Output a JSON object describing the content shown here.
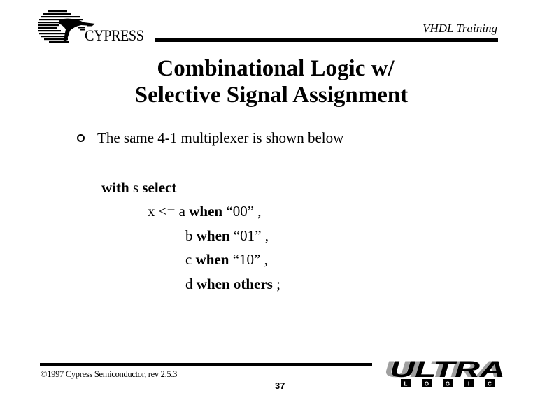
{
  "header": {
    "company_name": "CYPRESS",
    "course_title": "VHDL Training",
    "logo_icon": "cypress-tree-logo-icon"
  },
  "slide": {
    "title_line1": "Combinational Logic w/",
    "title_line2": "Selective Signal Assignment",
    "bullet_icon": "hollow-circle-bullet-icon",
    "bullet_text": "The same 4-1 multiplexer is shown below"
  },
  "code": {
    "line1": {
      "kw1": "with",
      "plain1": " s ",
      "kw2": "select"
    },
    "line2": {
      "plain1": "x <= a ",
      "kw1": "when",
      "plain2": " “00” ,"
    },
    "line3": {
      "plain1": "b ",
      "kw1": "when",
      "plain2": " “01” ,"
    },
    "line4": {
      "plain1": "c ",
      "kw1": "when",
      "plain2": " “10” ,"
    },
    "line5": {
      "plain1": "d ",
      "kw1": "when",
      "plain2": " ",
      "kw2": "others",
      "plain3": " ;"
    }
  },
  "footer": {
    "copyright": "©1997 Cypress Semiconductor, rev 2.5.3",
    "page_number": "37",
    "brand_word": "ULTRA",
    "brand_letters": [
      "L",
      "O",
      "G",
      "I",
      "C"
    ],
    "logo_icon": "ultra-logic-logo-icon"
  },
  "colors": {
    "text": "#000000",
    "background": "#ffffff",
    "logo_shadow": "#a0a0a0"
  }
}
